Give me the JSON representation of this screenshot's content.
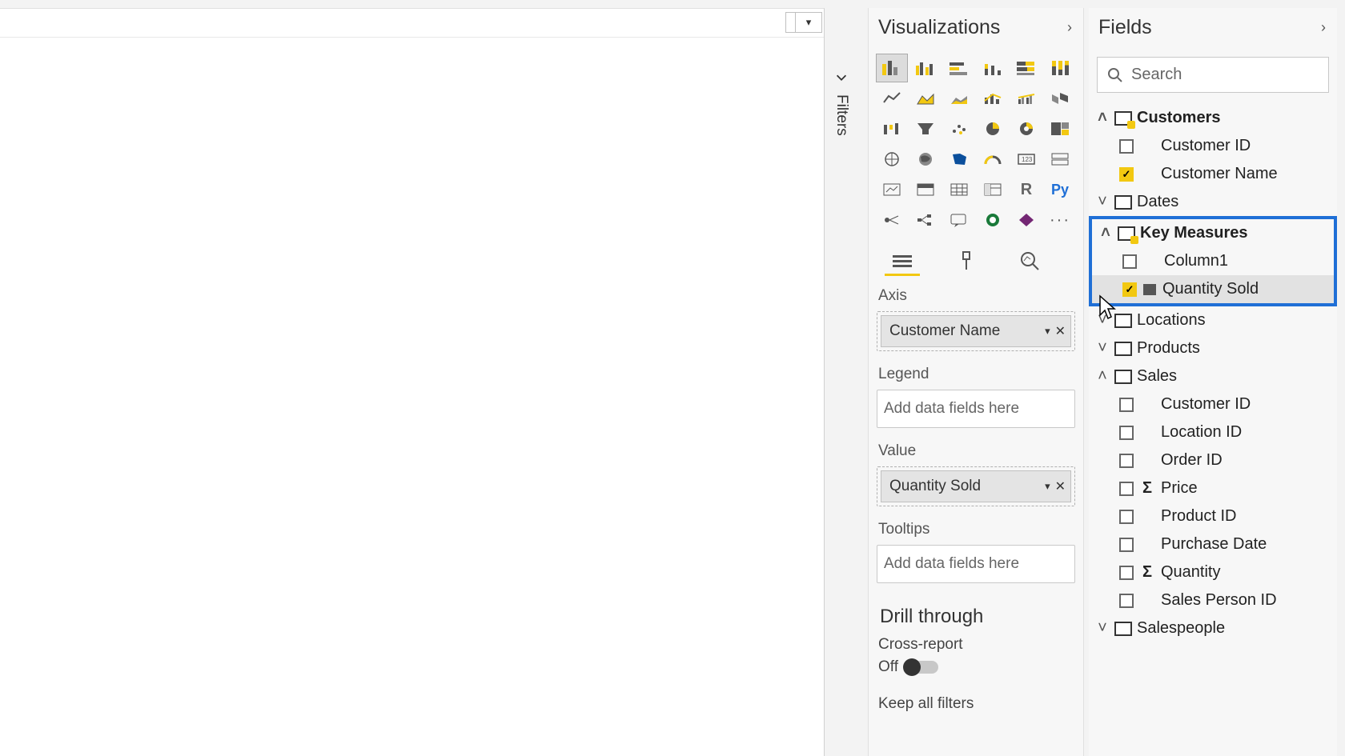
{
  "panes": {
    "visualizations": "Visualizations",
    "fields": "Fields",
    "filters": "Filters"
  },
  "search": {
    "placeholder": "Search"
  },
  "wells": {
    "axis": {
      "label": "Axis",
      "chip": "Customer Name"
    },
    "legend": {
      "label": "Legend",
      "placeholder": "Add data fields here"
    },
    "value": {
      "label": "Value",
      "chip": "Quantity Sold"
    },
    "tooltips": {
      "label": "Tooltips",
      "placeholder": "Add data fields here"
    }
  },
  "drill": {
    "title": "Drill through",
    "cross": "Cross-report",
    "off": "Off",
    "keep": "Keep all filters"
  },
  "tables": {
    "customers": {
      "name": "Customers",
      "fields": {
        "customer_id": "Customer ID",
        "customer_name": "Customer Name"
      }
    },
    "dates": {
      "name": "Dates"
    },
    "key_measures": {
      "name": "Key Measures",
      "fields": {
        "column1": "Column1",
        "quantity_sold": "Quantity Sold"
      }
    },
    "locations": {
      "name": "Locations"
    },
    "products": {
      "name": "Products"
    },
    "sales": {
      "name": "Sales",
      "fields": {
        "customer_id": "Customer ID",
        "location_id": "Location ID",
        "order_id": "Order ID",
        "price": "Price",
        "product_id": "Product ID",
        "purchase_date": "Purchase Date",
        "quantity": "Quantity",
        "sales_person_id": "Sales Person ID"
      }
    },
    "salespeople": {
      "name": "Salespeople"
    }
  }
}
